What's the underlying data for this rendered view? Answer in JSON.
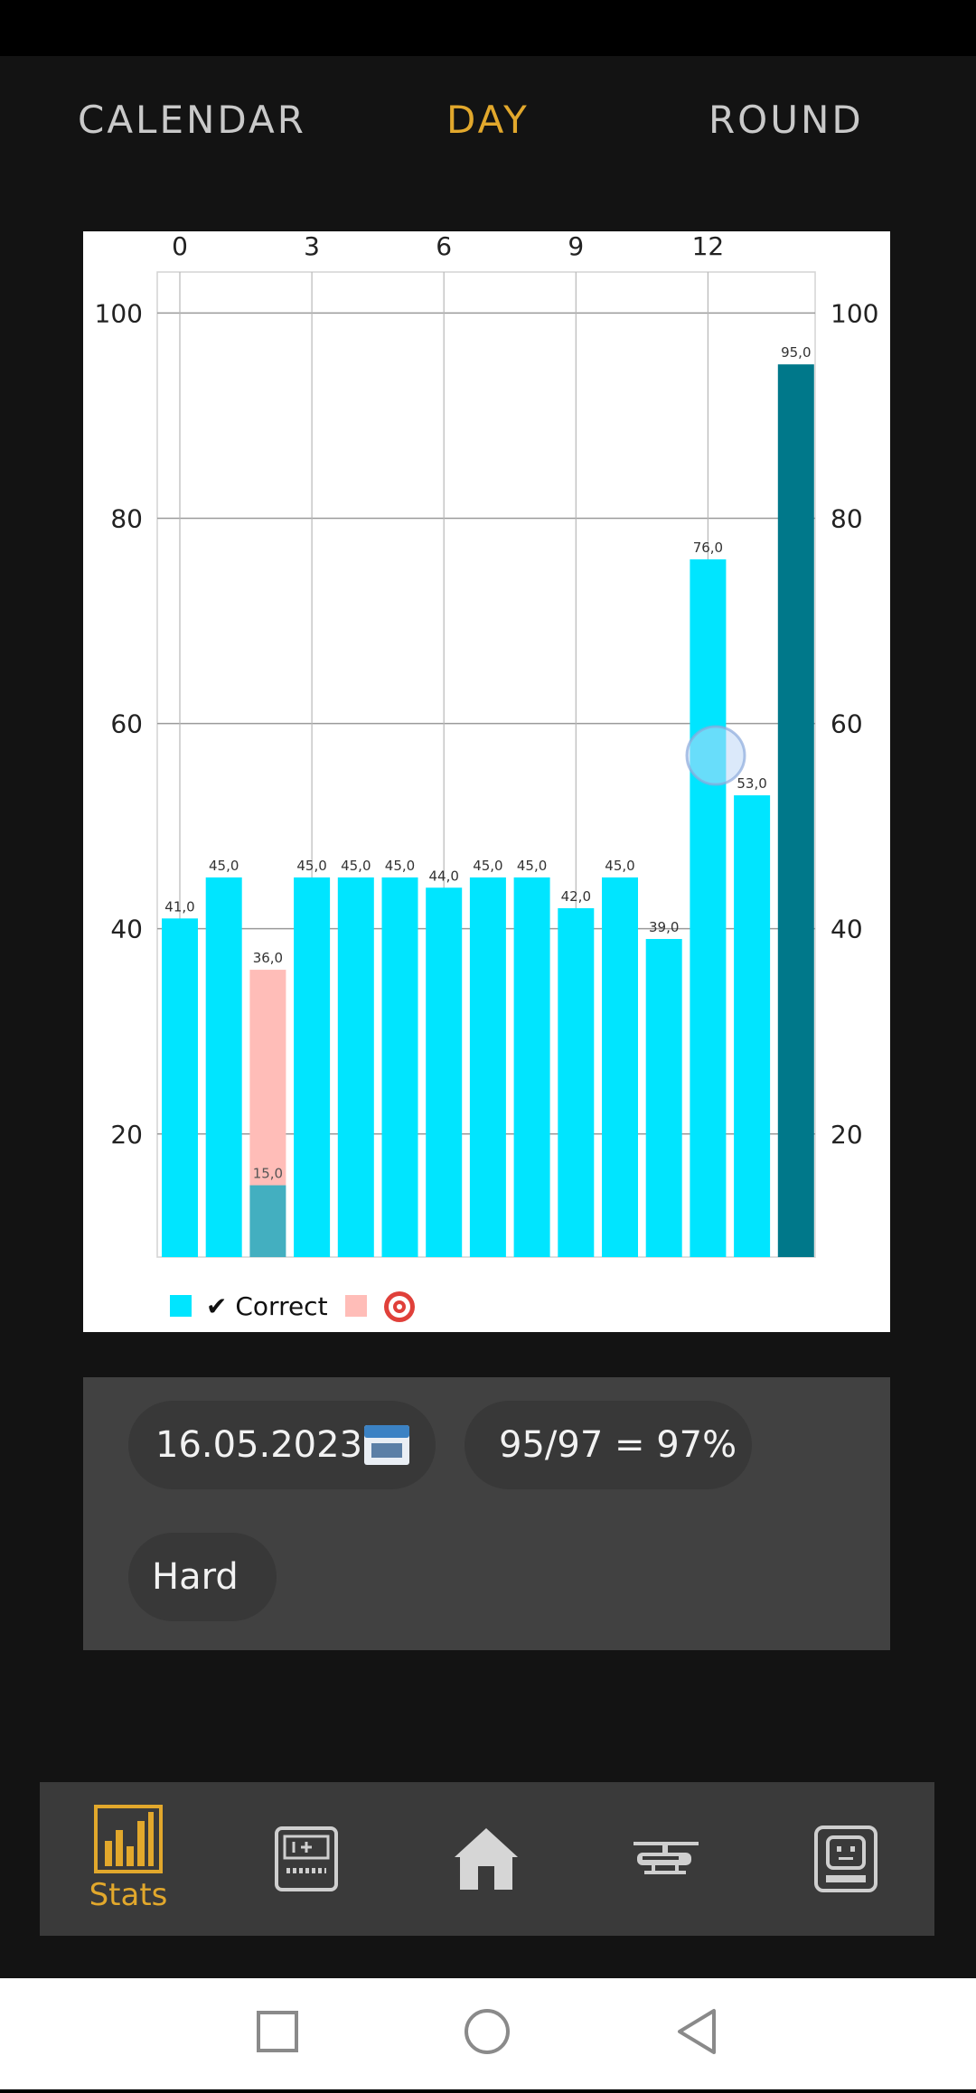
{
  "tabs": [
    {
      "label": "CALENDAR",
      "active": false
    },
    {
      "label": "DAY",
      "active": true
    },
    {
      "label": "ROUND",
      "active": false
    }
  ],
  "chart_data": {
    "type": "bar",
    "stacked": true,
    "x_ticks_top": [
      "0",
      "3",
      "6",
      "9",
      "12"
    ],
    "y_ticks": [
      20,
      40,
      60,
      80,
      100
    ],
    "ylim": [
      8,
      104
    ],
    "grid": true,
    "categories": [
      0,
      1,
      2,
      3,
      4,
      5,
      6,
      7,
      8,
      9,
      10,
      11,
      12,
      13,
      14
    ],
    "series": [
      {
        "name": "✔ Correct",
        "color": "#00e5ff",
        "values": [
          41,
          45,
          15,
          45,
          45,
          45,
          44,
          45,
          45,
          42,
          45,
          39,
          76,
          53,
          95
        ]
      },
      {
        "name": "🎯",
        "color": "#ffbdb8",
        "values": [
          0,
          0,
          21,
          0,
          0,
          0,
          0,
          0,
          0,
          0,
          0,
          0,
          0,
          0,
          0
        ]
      }
    ],
    "data_labels": [
      "41,0",
      "45,0",
      "36,0",
      "45,0",
      "45,0",
      "45,0",
      "44,0",
      "45,0",
      "45,0",
      "42,0",
      "45,0",
      "39,0",
      "76,0",
      "53,0",
      "95,0"
    ],
    "inner_labels": [
      {
        "index": 2,
        "label": "15,0"
      }
    ],
    "highlight_index": 14,
    "legend": {
      "placement": "bottom-left"
    }
  },
  "info": {
    "date": "16.05.2023",
    "score": "95/97 = 97%",
    "difficulty": "Hard"
  },
  "nav": {
    "stats_label": "Stats"
  },
  "colors": {
    "accent": "#e2a82c",
    "bar": "#00e5ff",
    "bar_selected": "#00788a",
    "bar_overlay": "#43afc0",
    "target_bar": "#ffbdb8"
  }
}
